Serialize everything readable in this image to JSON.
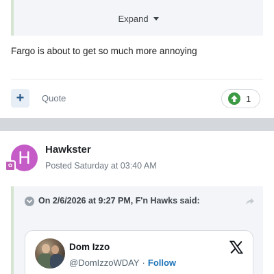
{
  "post1": {
    "expand_label": "Expand",
    "text": "Fargo is about to get so much more annoying",
    "actions": {
      "plus_label": "+",
      "quote_label": "Quote",
      "reputation_count": "1"
    }
  },
  "post2": {
    "avatar_letter": "H",
    "author": "Hawkster",
    "posted": "Posted Saturday at 03:40 AM",
    "quote": {
      "citation": "On 2/6/2026 at 9:27 PM, F'n Hawks said:"
    },
    "tweet": {
      "name": "Dom Izzo",
      "handle": "@DomIzzoWDAY",
      "separator": "·",
      "follow_label": "Follow"
    }
  },
  "colors": {
    "accent_blue": "#1d74b8",
    "reputation_green": "#3c9a45",
    "avatar_purple": "#c55bc6",
    "quote_bg": "#f3f5f8",
    "separator_band": "#d4d7db"
  },
  "icons": {
    "expand": "caret-down-icon",
    "reputation": "arrow-up-icon",
    "quote_toggle": "chevron-down-icon",
    "quote_share": "share-arrow-icon",
    "tweet_brand": "x-logo-icon",
    "rank": "rank-badge-icon"
  }
}
